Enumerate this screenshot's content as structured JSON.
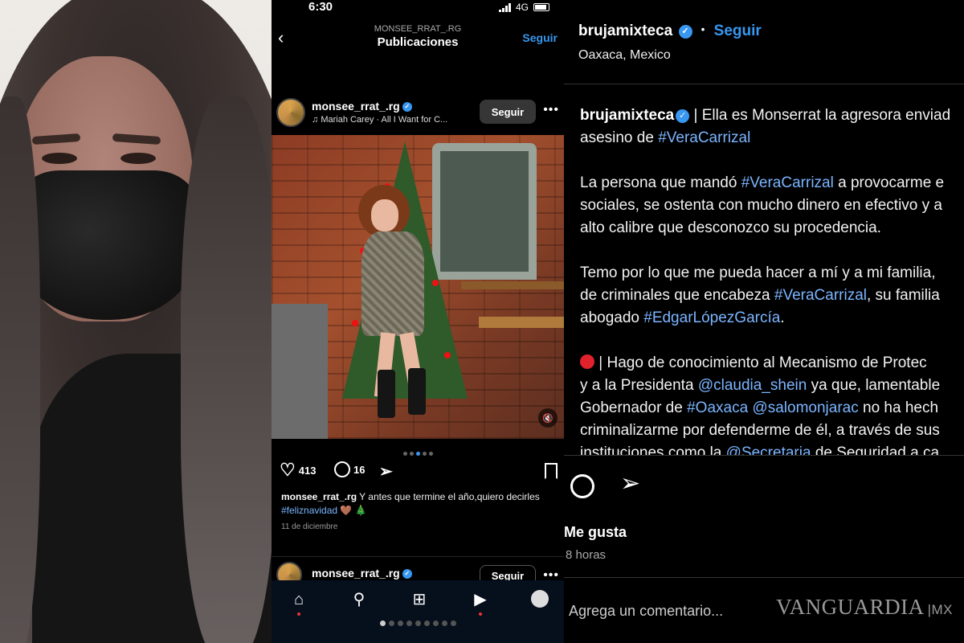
{
  "phone": {
    "status_bar": {
      "time": "6:30",
      "network": "4G"
    },
    "nav": {
      "username": "MONSEE_RRAT_.RG",
      "title": "Publicaciones",
      "follow_label": "Seguir"
    },
    "post": {
      "username": "monsee_rrat_.rg",
      "song": "Mariah Carey · All I Want for C...",
      "follow_label": "Seguir",
      "likes": "413",
      "comments": "16",
      "caption_user": "monsee_rrat_.rg",
      "caption_text": " Y antes que termine el año,quiero decirles ",
      "caption_hashtag": "#feliznavidad",
      "caption_emoji": " 🤎 🎄",
      "date": "11 de diciembre",
      "carousel_count": 5,
      "carousel_active": 3
    },
    "next_post": {
      "username": "monsee_rrat_.rg",
      "follow_label": "Seguir"
    },
    "tab_bar": {
      "icons": [
        "home-icon",
        "search-icon",
        "create-icon",
        "reels-icon",
        "profile-icon"
      ]
    }
  },
  "right": {
    "username": "brujamixteca",
    "separator": "•",
    "follow_label": "Seguir",
    "location": "Oaxaca, Mexico",
    "body": {
      "p1_user": "brujamixteca",
      "p1_text_a": " | Ella es Monserrat la agresora enviad",
      "p1_text_b": "asesino de ",
      "p1_tag": "#VeraCarrizal",
      "p2_a": "La persona que mandó ",
      "p2_tag": "#VeraCarrizal",
      "p2_b": " a provocarme e",
      "p2_c": "sociales, se ostenta con mucho dinero en efectivo y a",
      "p2_d": "alto calibre que desconozco su procedencia.",
      "p3_a": "Temo por lo que me pueda hacer a mí y a mi familia,",
      "p3_b": "de criminales que encabeza ",
      "p3_tag": "#VeraCarrizal",
      "p3_c": ", su familia",
      "p3_d": "abogado ",
      "p3_tag2": "#EdgarLópezGarcía",
      "p3_e": ".",
      "p4_a": " | Hago de conocimiento al Mecanismo de Protec",
      "p4_b": "y a la Presidenta ",
      "p4_tag": "@claudia_shein",
      "p4_c": " ya que, lamentable",
      "p4_d": "Gobernador de ",
      "p4_tag2": "#Oaxaca",
      "p4_e": " ",
      "p4_tag3": "@salomonjarac",
      "p4_f": " no ha hech",
      "p4_g": "criminalizarme por defenderme de él, a través de sus",
      "p4_h": "instituciones como la ",
      "p4_tag4": "@Secretaria",
      "p4_i": " de Seguridad a ca"
    },
    "likes_label": "Me gusta",
    "time": "8 horas",
    "comment_placeholder": "Agrega un comentario...",
    "watermark": "VANGUARDIA",
    "watermark_sub": "MX"
  },
  "colors": {
    "link": "#3897f0",
    "hashtag": "#7bb5ff",
    "alert": "#e0222c",
    "background": "#000000"
  }
}
